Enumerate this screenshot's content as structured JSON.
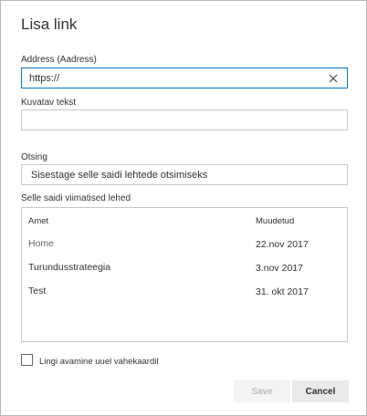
{
  "dialog": {
    "title": "Lisa link",
    "address": {
      "label": "Address (Aadress)",
      "value": "https://"
    },
    "display_text": {
      "label": "Kuvatav tekst",
      "value": ""
    },
    "search": {
      "label": "Otsing",
      "placeholder": "Sisestage selle saidi lehtede otsimiseks"
    },
    "recent_pages": {
      "label": "Selle saidi viimatised lehed",
      "columns": [
        "Amet",
        "Muudetud"
      ],
      "rows": [
        {
          "name": "Home",
          "modified": "22.nov 2017"
        },
        {
          "name": "Turundusstrateegia",
          "modified": "3.nov 2017"
        },
        {
          "name": "Test",
          "modified": "31. okt 2017"
        }
      ]
    },
    "new_tab": {
      "label": "Lingi avamine uuel vahekaardil",
      "checked": false
    },
    "buttons": {
      "save": "Save",
      "cancel": "Cancel"
    },
    "colors": {
      "focus_border": "#0078d4",
      "border": "#c8c8c8"
    }
  }
}
